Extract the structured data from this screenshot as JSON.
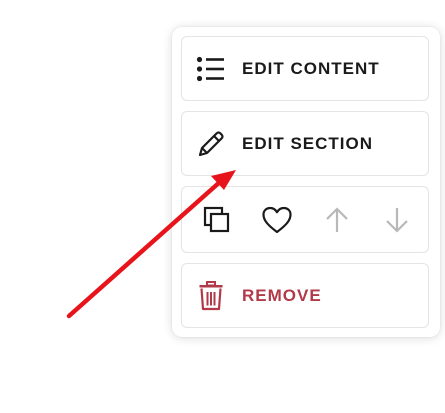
{
  "menu": {
    "edit_content_label": "EDIT CONTENT",
    "edit_section_label": "EDIT SECTION",
    "remove_label": "REMOVE"
  },
  "icons": {
    "edit_content": "list-icon",
    "edit_section": "pencil-icon",
    "duplicate": "duplicate-icon",
    "favorite": "heart-icon",
    "move_up": "arrow-up-icon",
    "move_down": "arrow-down-icon",
    "remove": "trash-icon"
  },
  "colors": {
    "text": "#1a1a1a",
    "danger": "#b23a48",
    "disabled_icon": "#b8b8b8",
    "annotation_arrow": "#e8141c"
  }
}
